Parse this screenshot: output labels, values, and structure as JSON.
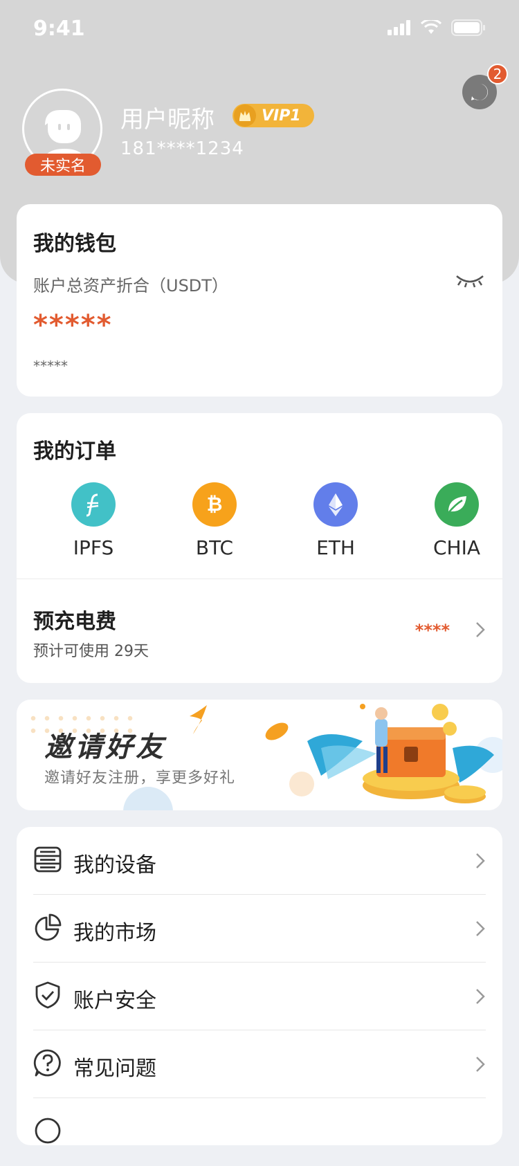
{
  "status": {
    "time": "9:41"
  },
  "profile": {
    "nickname": "用户昵称",
    "vip": "VIP1",
    "phone": "181****1234",
    "realname_badge": "未实名",
    "message_count": "2"
  },
  "wallet": {
    "title": "我的钱包",
    "subtitle": "账户总资产折合（USDT）",
    "masked_total": "*****",
    "masked_sub": "*****"
  },
  "orders": {
    "title": "我的订单",
    "coins": [
      {
        "label": "IPFS",
        "icon": "filecoin-icon",
        "color": "#42c1c7"
      },
      {
        "label": "BTC",
        "icon": "bitcoin-icon",
        "color": "#f7a21b"
      },
      {
        "label": "ETH",
        "icon": "ethereum-icon",
        "color": "#627eea"
      },
      {
        "label": "CHIA",
        "icon": "chia-leaf-icon",
        "color": "#3aac59"
      }
    ],
    "prepay_title": "预充电费",
    "prepay_sub": "预计可使用 29天",
    "prepay_masked": "****"
  },
  "invite": {
    "title": "邀请好友",
    "subtitle": "邀请好友注册，享更多好礼"
  },
  "menu": [
    {
      "label": "我的设备",
      "icon": "device-icon"
    },
    {
      "label": "我的市场",
      "icon": "market-chart-icon"
    },
    {
      "label": "账户安全",
      "icon": "shield-check-icon"
    },
    {
      "label": "常见问题",
      "icon": "question-icon"
    }
  ],
  "colors": {
    "accent": "#e25b30",
    "header": "#d6d6d6",
    "vip": "#f2b43a",
    "page": "#eef0f4"
  }
}
